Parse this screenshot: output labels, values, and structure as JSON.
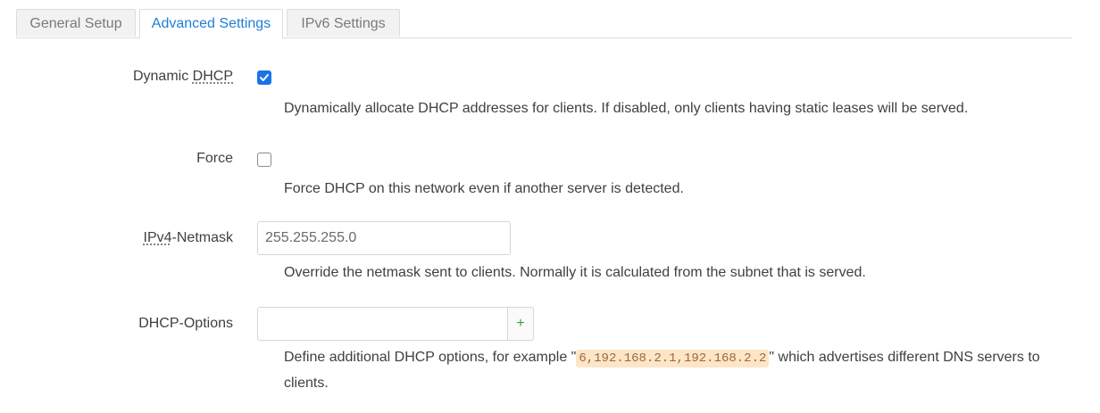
{
  "tabs": [
    {
      "label": "General Setup"
    },
    {
      "label": "Advanced Settings"
    },
    {
      "label": "IPv6 Settings"
    }
  ],
  "fields": {
    "dynamic_dhcp": {
      "label_prefix": "Dynamic ",
      "label_abbr": "DHCP",
      "checked": true,
      "description": "Dynamically allocate DHCP addresses for clients. If disabled, only clients having static leases will be served."
    },
    "force": {
      "label": "Force",
      "checked": false,
      "description": "Force DHCP on this network even if another server is detected."
    },
    "ipv4_netmask": {
      "label_abbr": "IPv4",
      "label_suffix": "-Netmask",
      "value": "255.255.255.0",
      "description": "Override the netmask sent to clients. Normally it is calculated from the subnet that is served."
    },
    "dhcp_options": {
      "label": "DHCP-Options",
      "value": "",
      "add_label": "+",
      "description_prefix": "Define additional DHCP options, for example \"",
      "description_code": "6,192.168.2.1,192.168.2.2",
      "description_suffix": "\" which advertises different DNS servers to clients."
    }
  },
  "colors": {
    "accent": "#1a73e8",
    "active_tab_text": "#1d7fd6",
    "add_button_text": "#3aa33a",
    "code_background": "#fde5c8"
  }
}
